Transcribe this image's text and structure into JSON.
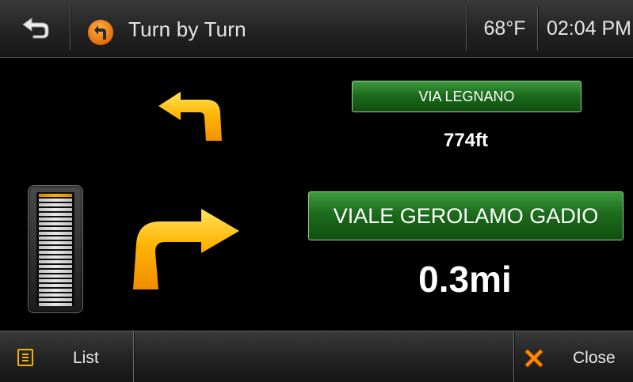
{
  "header": {
    "title": "Turn by Turn",
    "temperature": "68°F",
    "time": "02:04 PM"
  },
  "next_turn": {
    "street": "VIA LEGNANO",
    "distance": "774ft",
    "direction": "left"
  },
  "current_turn": {
    "street": "VIALE GEROLAMO GADIO",
    "distance": "0.3mi",
    "direction": "right"
  },
  "footer": {
    "list_label": "List",
    "close_label": "Close"
  },
  "icons": {
    "back": "back-arrow-icon",
    "title": "turn-by-turn-icon",
    "list": "list-icon",
    "close": "close-x-icon"
  },
  "colors": {
    "accent": "#f39200",
    "sign_green": "#1d6b1d",
    "arrow_yellow": "#ffb400"
  }
}
